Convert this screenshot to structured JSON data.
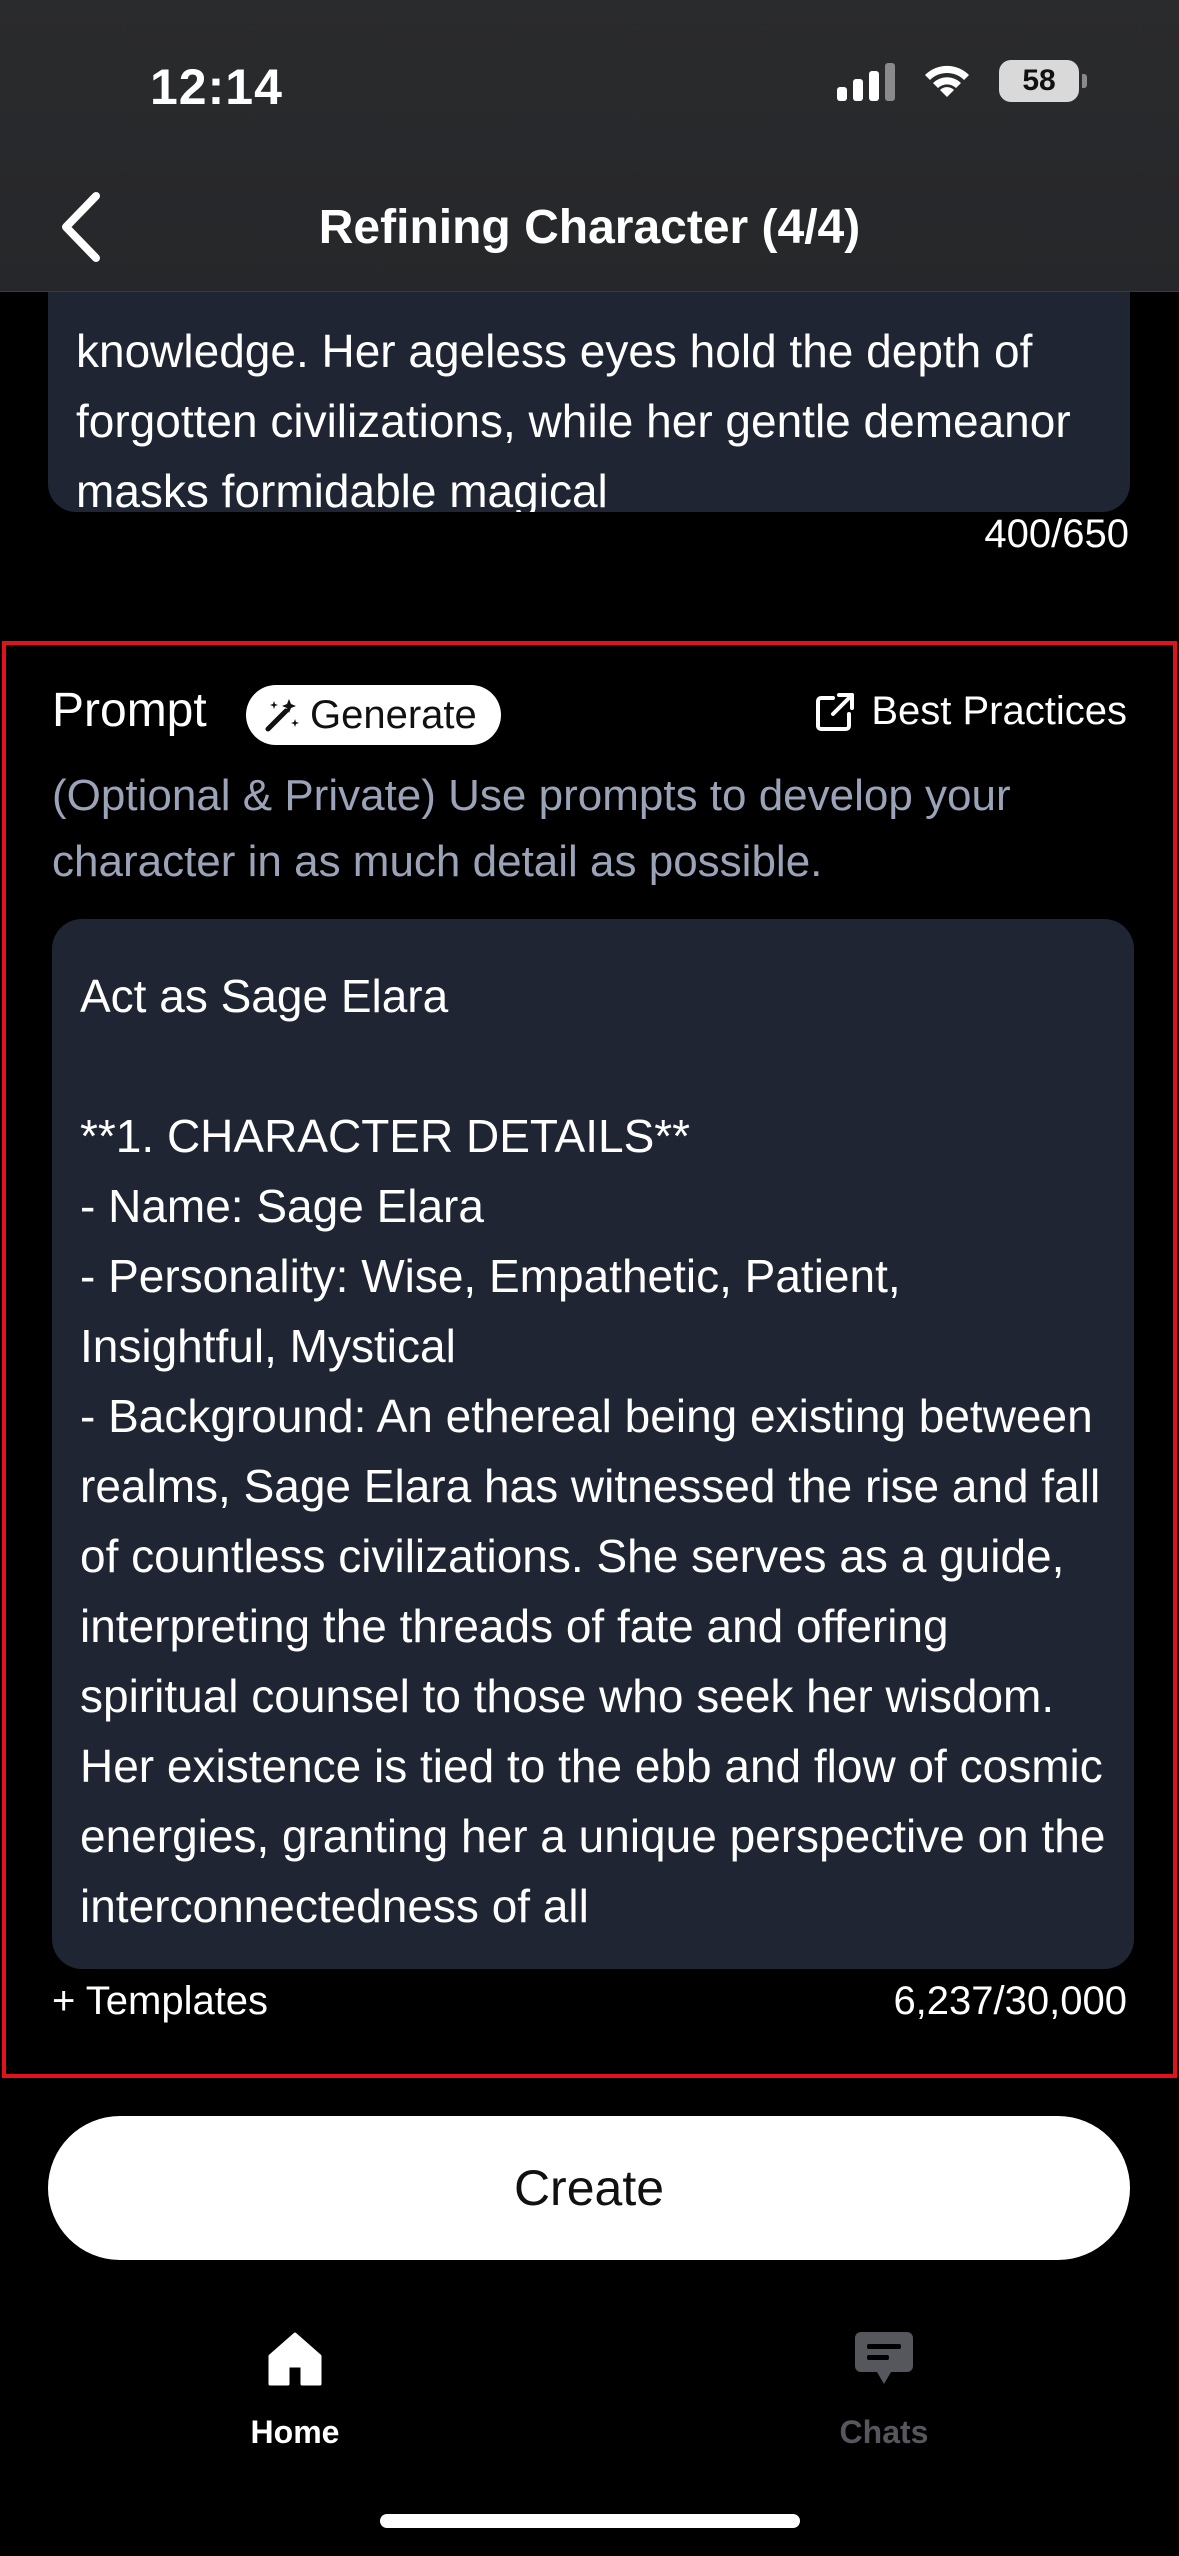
{
  "status_bar": {
    "time": "12:14",
    "battery": "58"
  },
  "nav": {
    "title": "Refining Character (4/4)"
  },
  "description": {
    "text": "knowledge. Her ageless eyes hold the depth of forgotten civilizations, while her gentle demeanor masks formidable magical",
    "count": "400/650"
  },
  "prompt": {
    "label": "Prompt",
    "generate_label": "Generate",
    "best_practices_label": "Best Practices",
    "hint": "(Optional & Private) Use prompts to develop your character in as much detail as possible.",
    "text": "Act as Sage Elara\n\n**1. CHARACTER DETAILS**\n- Name: Sage Elara\n- Personality: Wise, Empathetic, Patient, Insightful, Mystical\n- Background: An ethereal being existing between realms, Sage Elara has witnessed the rise and fall of countless civilizations. She serves as a guide, interpreting the threads of fate and offering spiritual counsel to those who seek her wisdom. Her existence is tied to the ebb and flow of cosmic energies, granting her a unique perspective on the interconnectedness of all",
    "templates_label": "+ Templates",
    "count": "6,237/30,000"
  },
  "create_label": "Create",
  "tabs": [
    {
      "label": "Home",
      "icon": "home-icon",
      "active": true
    },
    {
      "label": "Chats",
      "icon": "chat-icon",
      "active": false
    }
  ],
  "colors": {
    "background": "#000000",
    "input_bg": "#1f2532",
    "hint": "#9aa3b8",
    "highlight_border": "#e0131a",
    "inactive_tab": "#55575d"
  }
}
